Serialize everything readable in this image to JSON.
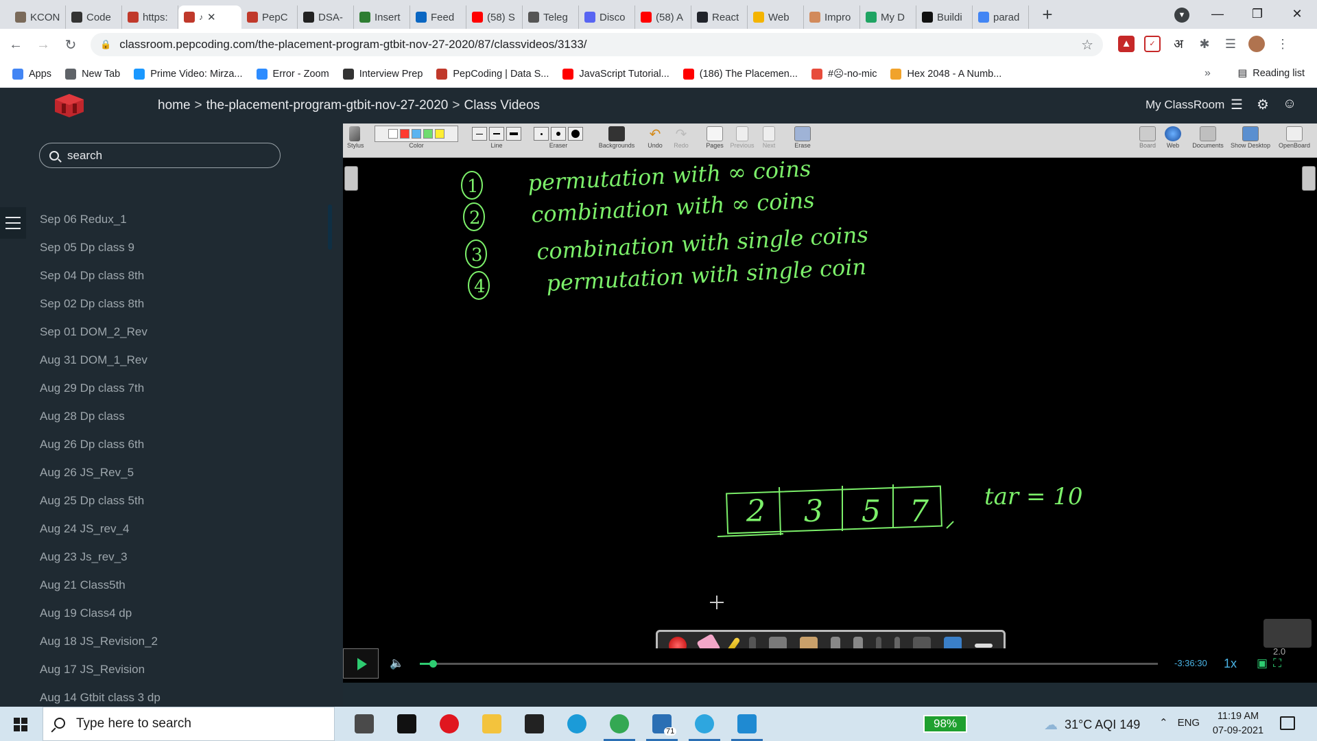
{
  "tabs": [
    {
      "title": "KCON",
      "icon": "wrench-icon",
      "color": "#7a6a5a"
    },
    {
      "title": "Code",
      "icon": "cc-icon",
      "color": "#333333"
    },
    {
      "title": "https:",
      "icon": "pepcoding-icon",
      "color": "#c0392b"
    },
    {
      "title": "",
      "icon": "pepcoding-icon",
      "color": "#c0392b",
      "active": true
    },
    {
      "title": "PepC",
      "icon": "pepcoding-icon",
      "color": "#c0392b"
    },
    {
      "title": "DSA-",
      "icon": "github-icon",
      "color": "#222222"
    },
    {
      "title": "Insert",
      "icon": "link-icon",
      "color": "#2e7d32"
    },
    {
      "title": "Feed",
      "icon": "linkedin-icon",
      "color": "#0a66c2"
    },
    {
      "title": "(58) S",
      "icon": "youtube-icon",
      "color": "#ff0000"
    },
    {
      "title": "Teleg",
      "icon": "globe-icon",
      "color": "#555555"
    },
    {
      "title": "Disco",
      "icon": "discord-icon",
      "color": "#5865f2"
    },
    {
      "title": "(58) A",
      "icon": "youtube-icon",
      "color": "#ff0000"
    },
    {
      "title": "React",
      "icon": "react-icon",
      "color": "#20232a"
    },
    {
      "title": "Web",
      "icon": "web-icon",
      "color": "#f4b400"
    },
    {
      "title": "Impro",
      "icon": "avatar-icon",
      "color": "#d28a5b"
    },
    {
      "title": "My D",
      "icon": "drive-icon",
      "color": "#1fa463"
    },
    {
      "title": "Buildi",
      "icon": "medium-icon",
      "color": "#111111"
    },
    {
      "title": "parad",
      "icon": "google-icon",
      "color": "#4285f4"
    }
  ],
  "address": {
    "url": "classroom.pepcoding.com/the-placement-program-gtbit-nov-27-2020/87/classvideos/3133/"
  },
  "bookmarks": [
    {
      "label": "Apps",
      "color": "#4285f4"
    },
    {
      "label": "New Tab",
      "color": "#5f6368"
    },
    {
      "label": "Prime Video: Mirza...",
      "color": "#1a98ff"
    },
    {
      "label": "Error - Zoom",
      "color": "#2d8cff"
    },
    {
      "label": "Interview Prep",
      "color": "#333333"
    },
    {
      "label": "PepCoding | Data S...",
      "color": "#c0392b"
    },
    {
      "label": "JavaScript Tutorial...",
      "color": "#ff0000"
    },
    {
      "label": "(186) The Placemen...",
      "color": "#ff0000"
    },
    {
      "label": "#☹-no-mic",
      "color": "#e74c3c"
    },
    {
      "label": "Hex 2048 - A Numb...",
      "color": "#f1a32b"
    }
  ],
  "reading_list": "Reading list",
  "header": {
    "crumbs": [
      "home",
      "the-placement-program-gtbit-nov-27-2020",
      "Class Videos"
    ],
    "myclassroom": "My ClassRoom"
  },
  "sidebar": {
    "search_placeholder": "search",
    "videos": [
      "Sep 06 Redux_1",
      "Sep 05 Dp class 9",
      "Sep 04 Dp class 8th",
      "Sep 02 Dp class 8th",
      "Sep 01 DOM_2_Rev",
      "Aug 31 DOM_1_Rev",
      "Aug 29 Dp class 7th",
      "Aug 28 Dp class",
      "Aug 26 Dp class 6th",
      "Aug 26 JS_Rev_5",
      "Aug 25 Dp class 5th",
      "Aug 24 JS_rev_4",
      "Aug 23 Js_rev_3",
      "Aug 21 Class5th",
      "Aug 19 Class4 dp",
      "Aug 18 JS_Revision_2",
      "Aug 17 JS_Revision",
      "Aug 14 Gtbit class 3 dp"
    ]
  },
  "board_toolbar": {
    "groups": [
      "Stylus",
      "Color",
      "Line",
      "Eraser",
      "Backgrounds",
      "Undo",
      "Redo",
      "Pages",
      "Previous",
      "Next",
      "Erase"
    ],
    "right_groups": [
      "Board",
      "Web",
      "Documents",
      "Show Desktop",
      "OpenBoard"
    ],
    "colors": [
      "#ffffff",
      "#ff3b30",
      "#5ab4f0",
      "#6fdc6f",
      "#ffee33"
    ]
  },
  "board": {
    "ink_color": "#7cf06a",
    "list": [
      {
        "num": "1",
        "text": "permutation with ∞ coins"
      },
      {
        "num": "2",
        "text": "combination with ∞ coins"
      },
      {
        "num": "3",
        "text": "combination with single coins"
      },
      {
        "num": "4",
        "text": "permutation with single coin"
      }
    ],
    "array": [
      "2",
      "3",
      "5",
      "7"
    ],
    "target": "tar = 10"
  },
  "player": {
    "time_remaining": "-3:36:30",
    "speed": "1x",
    "zoom": "2.0",
    "progress": 0.018
  },
  "taskbar": {
    "search_placeholder": "Type here to search",
    "battery": "98%",
    "weather": "31°C  AQI 149",
    "lang": "ENG",
    "time": "11:19 AM",
    "date": "07-09-2021",
    "telegram_badge": "71",
    "apps": [
      {
        "name": "mail-icon",
        "color": "#4a4a4a"
      },
      {
        "name": "letter-l-icon",
        "color": "#111111"
      },
      {
        "name": "opera-icon",
        "color": "#e0161f"
      },
      {
        "name": "folder-icon",
        "color": "#f3c33d"
      },
      {
        "name": "store-icon",
        "color": "#222222"
      },
      {
        "name": "edge-icon",
        "color": "#1b9bd8"
      },
      {
        "name": "chrome-icon",
        "color": "#34a853",
        "running": true
      },
      {
        "name": "file-icon",
        "color": "#2b6fb4",
        "running": true
      },
      {
        "name": "telegram-icon",
        "color": "#2ea6df",
        "running": true
      },
      {
        "name": "vscode-icon",
        "color": "#1f8ad2",
        "running": true
      }
    ]
  }
}
